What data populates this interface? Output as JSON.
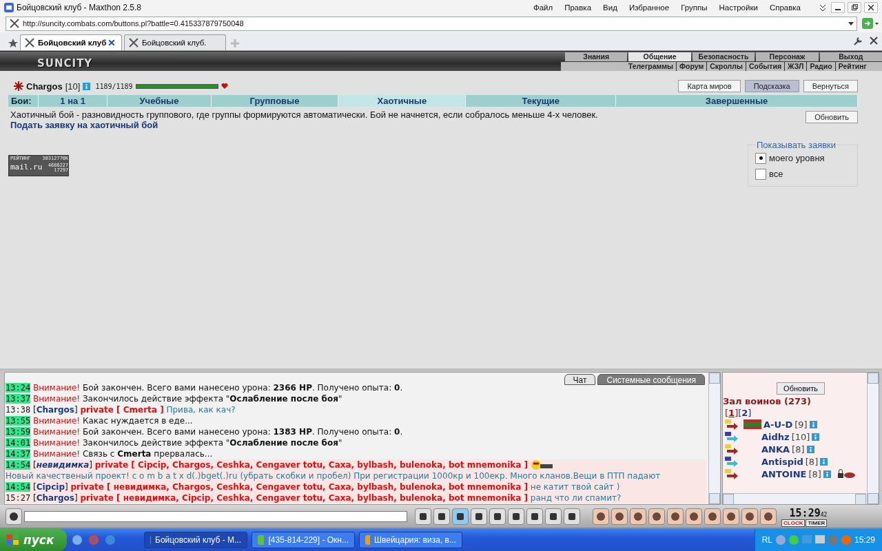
{
  "browser": {
    "title": "Бойцовский клуб - Maxthon 2.5.8",
    "menu": [
      "Файл",
      "Правка",
      "Вид",
      "Избранное",
      "Группы",
      "Настройки",
      "Справка"
    ],
    "address": "http://suncity.combats.com/buttons.pl?battle=0.415337879750048",
    "tabs": [
      {
        "label": "Бойцовский клуб",
        "selected": true
      },
      {
        "label": "Бойцовский клуб.",
        "selected": false
      }
    ]
  },
  "game_nav": {
    "logo": "SUNCITY",
    "top_links": [
      {
        "label": "Знания",
        "selected": false
      },
      {
        "label": "Общение",
        "selected": true
      },
      {
        "label": "Безопасность",
        "selected": false
      },
      {
        "label": "Персонаж",
        "selected": false
      },
      {
        "label": "Выход",
        "selected": false
      }
    ],
    "sub_links": [
      "Телеграммы",
      "Форум",
      "Скроллы",
      "События",
      "ЖЗЛ",
      "Радио",
      "Рейтинг"
    ]
  },
  "player": {
    "name": "Chargos",
    "level": "[10]",
    "hp": "1189/1189",
    "hp_bar": {
      "level": 1
    }
  },
  "top_buttons": [
    {
      "label": "Карта миров",
      "selected": false
    },
    {
      "label": "Подсказка",
      "selected": true
    },
    {
      "label": "Вернуться",
      "selected": false
    }
  ],
  "battle_tabs": {
    "label": "Бои:",
    "tabs": [
      {
        "label": "1 на 1",
        "selected": false
      },
      {
        "label": "Учебные",
        "selected": false
      },
      {
        "label": "Групповые",
        "selected": false
      },
      {
        "label": "Хаотичные",
        "selected": true
      },
      {
        "label": "Текущие",
        "selected": false
      },
      {
        "label": "Завершенные",
        "selected": false
      }
    ]
  },
  "description": "Хаотичный бой - разновидность группового, где группы формируются автоматически. Бой не начнется, если собралось меньше 4-х человек.",
  "apply_link": "Подать заявку на хаотичный бой",
  "refresh_button": "Обновить",
  "counter": {
    "title": "РЕЙТИНГ",
    "total": "30312770К",
    "brand": "mail.ru",
    "hits": "4686227",
    "hosts": "17297"
  },
  "filter": {
    "legend": "Показывать заявки",
    "options": [
      {
        "label": "моего уровня",
        "selected": true
      },
      {
        "label": "все",
        "selected": false
      }
    ]
  },
  "chat": {
    "tabs": [
      {
        "label": "Чат",
        "selected": true
      },
      {
        "label": "Системные сообщения",
        "selected": false
      }
    ],
    "messages": [
      {
        "kind": "system",
        "time": "13:24",
        "time_marked": true,
        "row_marked": false,
        "label": "Внимание!",
        "text": "Бой закончен. Всего вами нанесено урона: **2366 HP**. Получено опыта: **0**."
      },
      {
        "kind": "system",
        "time": "13:37",
        "time_marked": true,
        "row_marked": false,
        "label": "Внимание!",
        "text": "Закончилось действие эффекта \"**Ослабление после боя**\""
      },
      {
        "kind": "private",
        "time": "13:38",
        "time_marked": false,
        "row_marked": false,
        "sender": "[**Chargos**]",
        "to": "private [ Cmerta ]",
        "text": "Прива, как кач?"
      },
      {
        "kind": "system",
        "time": "13:55",
        "time_marked": true,
        "row_marked": false,
        "label": "Внимание!",
        "text": "Какас нуждается в еде..."
      },
      {
        "kind": "system",
        "time": "13:59",
        "time_marked": true,
        "row_marked": false,
        "label": "Внимание!",
        "text": "Бой закончен. Всего вами нанесено урона: **1383 HP**. Получено опыта: **0**."
      },
      {
        "kind": "system",
        "time": "14:01",
        "time_marked": true,
        "row_marked": false,
        "label": "Внимание!",
        "text": "Закончилось действие эффекта \"**Ослабление после боя**\""
      },
      {
        "kind": "system",
        "time": "14:37",
        "time_marked": true,
        "row_marked": false,
        "label": "Внимание!",
        "text": "Связь с **Cmerta** прервалась..."
      },
      {
        "kind": "private",
        "time": "14:54",
        "time_marked": true,
        "row_marked": true,
        "sender": "[*невидимка*]",
        "to": "private [ Cipcip, Chargos, Ceshka, Cengaver totu, Caxa, bylbash, bulenoka, bot mnemonika ]",
        "smiley": true,
        "text": "Новый качественый проект! c o m b a t x d(.)bget(.)ru (убрать скобки и пробел) При регистрации 1000кр и 100екр. Много кланов.Вещи в ПТП падают"
      },
      {
        "kind": "private",
        "time": "14:54",
        "time_marked": true,
        "row_marked": true,
        "sender": "[**Cipcip**]",
        "to": "private [ невидимка, Chargos, Ceshka, Cengaver totu, Caxa, bylbash, bulenoka, bot mnemonika ]",
        "text": "не катит твой сайт )"
      },
      {
        "kind": "private",
        "time": "15:27",
        "time_marked": false,
        "row_marked": true,
        "sender": "[**Chargos**]",
        "to": "private [ невидимка, Cipcip, Ceshka, Cengaver totu, Caxa, bylbash, bulenoka, bot mnemonika ]",
        "text": "ранд что ли спамит?"
      }
    ]
  },
  "users": {
    "refresh_button": "Обновить",
    "title": "Зал воинов (273)",
    "pages": [
      {
        "label": "[**1**]",
        "selected": true
      },
      {
        "label": "[**2**]",
        "selected": false
      }
    ],
    "list": [
      {
        "kind": "warm",
        "name": "A-U-D",
        "level": "[9]",
        "flag": true
      },
      {
        "kind": "cool",
        "name": "Aidhz",
        "level": "[10]"
      },
      {
        "kind": "warm",
        "name": "ANKA",
        "level": "[8]"
      },
      {
        "kind": "cool",
        "name": "Antispid",
        "level": "[8]"
      },
      {
        "kind": "warm",
        "name": "ANTOINE",
        "level": "[8]",
        "locked": true
      }
    ]
  },
  "clock": {
    "time": "15:29",
    "seconds": "42",
    "clock_label": "CLOCK",
    "timer_label": "TIMER"
  },
  "taskbar": {
    "start": "пуск",
    "tasks": [
      {
        "label": "Бойцовский клуб - M...",
        "selected": true
      },
      {
        "label": "[435-814-229] - Окн...",
        "selected": false
      },
      {
        "label": "Швейцария: виза, в...",
        "selected": false
      }
    ],
    "lang": "RL",
    "time": "15:29"
  }
}
